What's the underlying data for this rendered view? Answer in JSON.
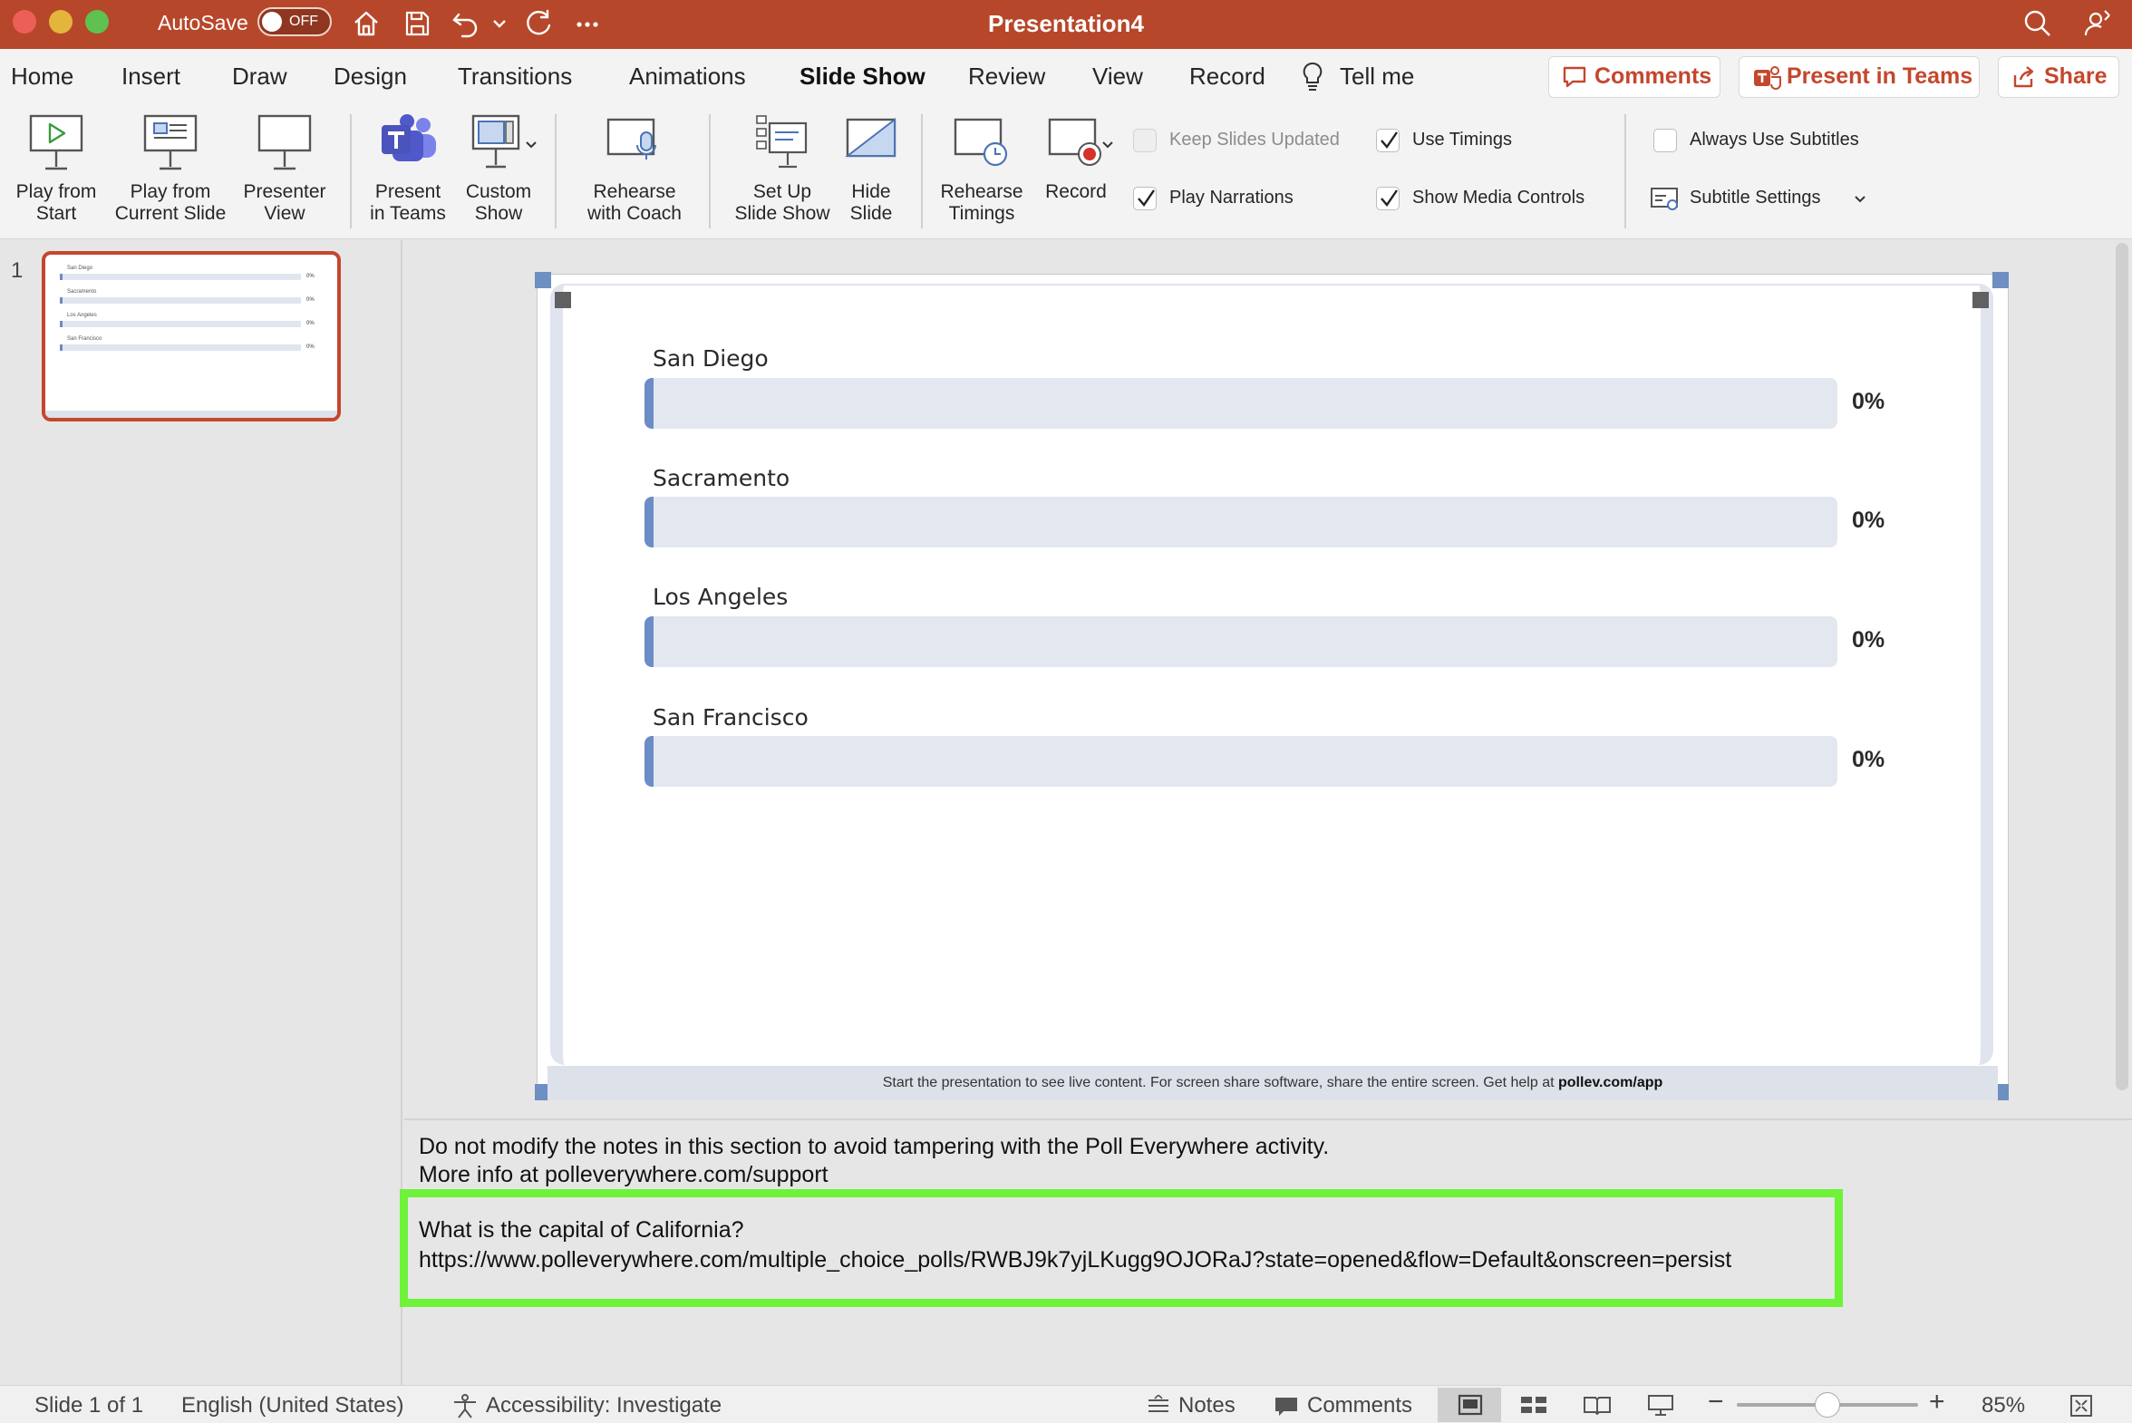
{
  "window": {
    "title": "Presentation4",
    "autosave_label": "AutoSave",
    "autosave_state": "OFF",
    "traffic_light_colors": [
      "#ec5f57",
      "#e3b53b",
      "#5fc150"
    ],
    "icons": [
      "home-icon",
      "save-icon",
      "undo-icon",
      "dropdown-icon",
      "redo-icon",
      "more-icon",
      "search-icon",
      "share-person-icon"
    ]
  },
  "tabs": [
    {
      "label": "Home",
      "active": false
    },
    {
      "label": "Insert",
      "active": false
    },
    {
      "label": "Draw",
      "active": false
    },
    {
      "label": "Design",
      "active": false
    },
    {
      "label": "Transitions",
      "active": false
    },
    {
      "label": "Animations",
      "active": false
    },
    {
      "label": "Slide Show",
      "active": true
    },
    {
      "label": "Review",
      "active": false
    },
    {
      "label": "View",
      "active": false
    },
    {
      "label": "Record",
      "active": false
    },
    {
      "label": "Tell me",
      "active": false
    }
  ],
  "top_buttons": {
    "comments": "Comments",
    "present_in_teams": "Present in Teams",
    "share": "Share"
  },
  "ribbon": {
    "buttons": [
      {
        "line1": "Play from",
        "line2": "Start"
      },
      {
        "line1": "Play from",
        "line2": "Current Slide"
      },
      {
        "line1": "Presenter",
        "line2": "View"
      },
      {
        "line1": "Present",
        "line2": "in Teams"
      },
      {
        "line1": "Custom",
        "line2": "Show"
      },
      {
        "line1": "Rehearse",
        "line2": "with Coach"
      },
      {
        "line1": "Set Up",
        "line2": "Slide Show"
      },
      {
        "line1": "Hide",
        "line2": "Slide"
      },
      {
        "line1": "Rehearse",
        "line2": "Timings"
      },
      {
        "line1": "Record",
        "line2": ""
      }
    ],
    "checkboxes": [
      {
        "label": "Keep Slides Updated",
        "checked": false,
        "enabled": false
      },
      {
        "label": "Use Timings",
        "checked": true,
        "enabled": true
      },
      {
        "label": "Play Narrations",
        "checked": true,
        "enabled": true
      },
      {
        "label": "Show Media Controls",
        "checked": true,
        "enabled": true
      },
      {
        "label": "Always Use Subtitles",
        "checked": false,
        "enabled": true
      }
    ],
    "subtitle_settings": "Subtitle Settings"
  },
  "thumbnails": {
    "slide_number": "1",
    "labels": [
      "San Diego",
      "Sacramento",
      "Los Angeles",
      "San Francisco"
    ],
    "percents": [
      "0%",
      "0%",
      "0%",
      "0%"
    ]
  },
  "slide": {
    "accent_color": "#6b8dc6",
    "options": [
      {
        "label": "San Diego",
        "percent": "0%",
        "value": 0
      },
      {
        "label": "Sacramento",
        "percent": "0%",
        "value": 0
      },
      {
        "label": "Los Angeles",
        "percent": "0%",
        "value": 0
      },
      {
        "label": "San Francisco",
        "percent": "0%",
        "value": 0
      }
    ],
    "footer_text": "Start the presentation to see live content. For screen share software, share the entire screen. Get help at ",
    "footer_link": "pollev.com/app"
  },
  "notes": {
    "line1": "Do not modify the notes in this section to avoid tampering with the Poll Everywhere activity.",
    "line2": "More info at polleverywhere.com/support",
    "question": "What is the capital of California?",
    "url": "https://www.polleverywhere.com/multiple_choice_polls/RWBJ9k7yjLKugg9OJORaJ?state=opened&flow=Default&onscreen=persist",
    "highlight_color": "#6ef23a"
  },
  "status": {
    "slide_info": "Slide 1 of 1",
    "language": "English (United States)",
    "accessibility": "Accessibility: Investigate",
    "notes": "Notes",
    "comments": "Comments",
    "zoom": "85%",
    "zoom_fraction": 0.5
  }
}
